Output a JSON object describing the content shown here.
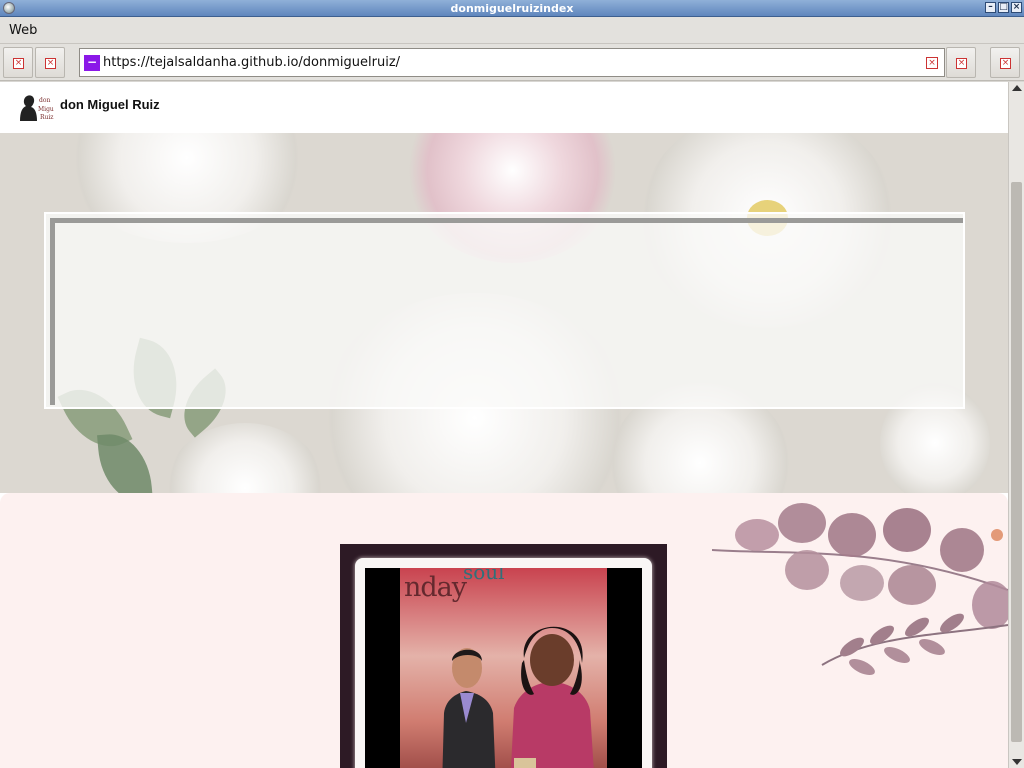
{
  "window": {
    "title": "donmiguelruizindex"
  },
  "menubar": {
    "items": [
      "Web"
    ]
  },
  "toolbar": {
    "url": "https://tejalsaldanha.github.io/donmiguelruiz/"
  },
  "site": {
    "brand": "don Miguel Ruiz",
    "logo_text": "don Miguel Ruiz",
    "photo_sign_1": "nday",
    "photo_sign_2": "soul"
  },
  "colors": {
    "title_bar": "#6f93c8",
    "url_site_icon": "#8b18e8",
    "lower_background": "#fdf1f0",
    "photo_frame": "#2d1a25"
  }
}
